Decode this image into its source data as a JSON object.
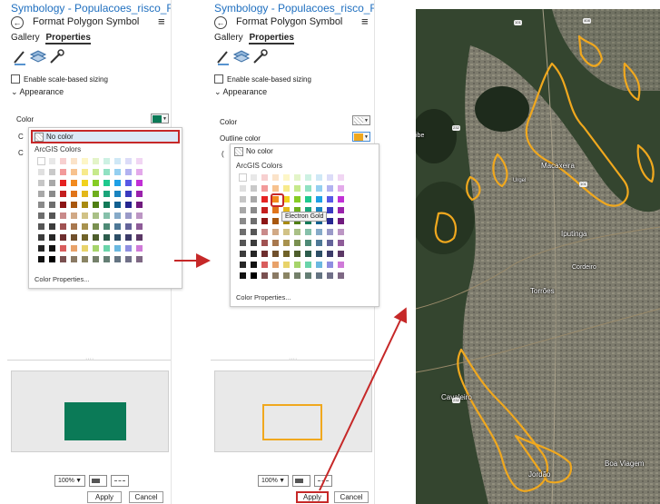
{
  "panel": {
    "title": "Symbology - Populacoes_risco_Rec...",
    "subtitle": "Format Polygon Symbol",
    "tabs": [
      "Gallery",
      "Properties"
    ],
    "scale_sizing": "Enable scale-based sizing",
    "appearance": "Appearance",
    "color_label": "Color",
    "outline_label": "Outline color",
    "no_color": "No color",
    "palette_title": "ArcGIS Colors",
    "color_properties": "Color Properties...",
    "zoom": "100%",
    "apply": "Apply",
    "cancel": "Cancel"
  },
  "tooltip": "Electron Gold",
  "colors": {
    "fill_green": "#0b7a57",
    "outline_gold": "#f0a81e",
    "title_blue": "#1f6fbf",
    "highlight_red": "#c62828"
  },
  "palette": [
    [
      "#ffffff",
      "#e8e8e8",
      "#f7d0d0",
      "#fbe3c9",
      "#fdf6c7",
      "#e3f4c8",
      "#cdf1e3",
      "#cfe8f6",
      "#dcdcf8",
      "#f1d6f3"
    ],
    [
      "#e0e0e0",
      "#c9c9c9",
      "#f29a9a",
      "#f7c28e",
      "#f7ea8c",
      "#c6e98c",
      "#90e1c2",
      "#94cff0",
      "#b2b2f0",
      "#e3a9ea"
    ],
    [
      "#c6c6c6",
      "#a8a8a8",
      "#e52222",
      "#f28a1e",
      "#f1d21d",
      "#86cc24",
      "#1ec98e",
      "#1ea0e6",
      "#5858e6",
      "#c12fd6"
    ],
    [
      "#a8a8a8",
      "#8a8a8a",
      "#c41e1e",
      "#e0741a",
      "#e3b81a",
      "#6fae1c",
      "#1aa57a",
      "#1a84c0",
      "#3a3ac0",
      "#9a22ac"
    ],
    [
      "#8a8a8a",
      "#6e6e6e",
      "#8c1414",
      "#a8570f",
      "#a88a0f",
      "#4f7f12",
      "#127a58",
      "#126090",
      "#262690",
      "#701a7e"
    ],
    [
      "#6e6e6e",
      "#565656",
      "#c98a8a",
      "#d1a986",
      "#d1c286",
      "#a9c086",
      "#86c0aa",
      "#86aac8",
      "#9a9ac8",
      "#bc96c4"
    ],
    [
      "#565656",
      "#3c3c3c",
      "#a05252",
      "#a8784e",
      "#a8924e",
      "#7a9050",
      "#4e8a76",
      "#4e7896",
      "#64649a",
      "#8e5c98"
    ],
    [
      "#3c3c3c",
      "#262626",
      "#6e2e2e",
      "#70502c",
      "#706228",
      "#4e5e2c",
      "#2c5c4c",
      "#2c4e66",
      "#3c3c6a",
      "#5c3866"
    ],
    [
      "#262626",
      "#121212",
      "#d95c5c",
      "#e8a26a",
      "#e8d36a",
      "#a6d46a",
      "#6ad4aa",
      "#6ab8e0",
      "#8e8ee0",
      "#cf7ad8"
    ],
    [
      "#121212",
      "#000000",
      "#7a5050",
      "#8a7a64",
      "#8a8464",
      "#74806a",
      "#647e74",
      "#647482",
      "#707088",
      "#7e6884"
    ]
  ],
  "map": {
    "labels": [
      "Macaxeira",
      "Urgel",
      "Iputinga",
      "Cordeiro",
      "Torrões",
      "Cavaleiro",
      "Jordão",
      "Boa Viagem",
      "ibe"
    ],
    "shields": [
      "101",
      "232",
      "408",
      "232",
      "101"
    ]
  }
}
